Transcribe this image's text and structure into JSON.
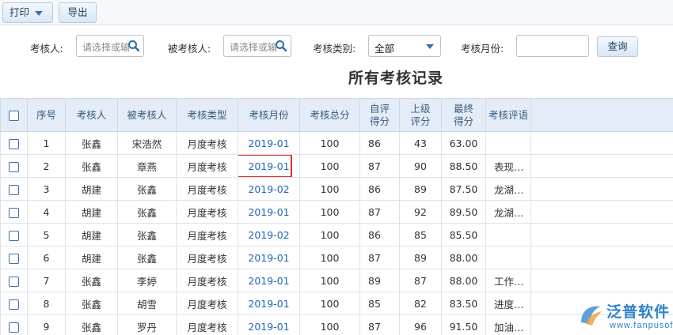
{
  "toolbar": {
    "print": "打印",
    "export": "导出"
  },
  "filters": {
    "assessor_label": "考核人:",
    "assessor_placeholder": "请选择或输",
    "assessee_label": "被考核人:",
    "assessee_placeholder": "请选择或输",
    "type_label": "考核类别:",
    "type_value": "全部",
    "month_label": "考核月份:",
    "month_value": "",
    "query": "查询"
  },
  "title": "所有考核记录",
  "table": {
    "headers": {
      "seq": "序号",
      "assessor": "考核人",
      "assessee": "被考核人",
      "type": "考核类型",
      "month": "考核月份",
      "total": "考核总分",
      "self1": "自评",
      "self2": "得分",
      "sup1": "上级",
      "sup2": "评分",
      "final1": "最终",
      "final2": "得分",
      "comment": "考核评语"
    },
    "rows": [
      {
        "seq": "1",
        "assessor": "张鑫",
        "assessee": "宋浩然",
        "type": "月度考核",
        "month": "2019-01",
        "total": "100",
        "self": "86",
        "sup": "43",
        "final": "63.00",
        "comment": ""
      },
      {
        "seq": "2",
        "assessor": "张鑫",
        "assessee": "章燕",
        "type": "月度考核",
        "month": "2019-01",
        "total": "100",
        "self": "87",
        "sup": "90",
        "final": "88.50",
        "comment": "表现不错，继续加油"
      },
      {
        "seq": "3",
        "assessor": "胡建",
        "assessee": "张鑫",
        "type": "月度考核",
        "month": "2019-02",
        "total": "100",
        "self": "86",
        "sup": "89",
        "final": "87.50",
        "comment": "龙湖项目这个月打款效果不错，..."
      },
      {
        "seq": "4",
        "assessor": "胡建",
        "assessee": "张鑫",
        "type": "月度考核",
        "month": "2019-01",
        "total": "100",
        "self": "87",
        "sup": "92",
        "final": "89.50",
        "comment": "龙湖项目的款项催促下个月抓紧..."
      },
      {
        "seq": "5",
        "assessor": "胡建",
        "assessee": "张鑫",
        "type": "月度考核",
        "month": "2019-02",
        "total": "100",
        "self": "86",
        "sup": "85",
        "final": "85.50",
        "comment": ""
      },
      {
        "seq": "6",
        "assessor": "胡建",
        "assessee": "张鑫",
        "type": "月度考核",
        "month": "2019-01",
        "total": "100",
        "self": "87",
        "sup": "89",
        "final": "88.00",
        "comment": ""
      },
      {
        "seq": "7",
        "assessor": "张鑫",
        "assessee": "李婷",
        "type": "月度考核",
        "month": "2019-01",
        "total": "100",
        "self": "89",
        "sup": "87",
        "final": "88.00",
        "comment": "工作完成得不错，季度优秀员工..."
      },
      {
        "seq": "8",
        "assessor": "张鑫",
        "assessee": "胡雪",
        "type": "月度考核",
        "month": "2019-01",
        "total": "100",
        "self": "85",
        "sup": "82",
        "final": "83.50",
        "comment": "进度管理有待加强，管理过程中..."
      },
      {
        "seq": "9",
        "assessor": "张鑫",
        "assessee": "罗丹",
        "type": "月度考核",
        "month": "2019-01",
        "total": "100",
        "self": "87",
        "sup": "96",
        "final": "91.50",
        "comment": "加油，工作成果越来越突出了。"
      }
    ]
  },
  "watermark": {
    "name": "泛普软件",
    "site": "www.fanpusoft.com"
  },
  "colors": {
    "accent": "#1f66b3",
    "header_bg": "#e4edf7",
    "highlight": "#e0302c"
  }
}
